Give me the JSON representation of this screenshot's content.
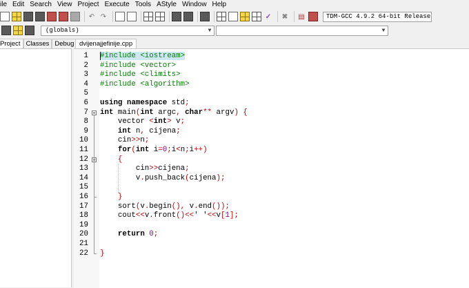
{
  "menu": [
    "ile",
    "Edit",
    "Search",
    "View",
    "Project",
    "Execute",
    "Tools",
    "AStyle",
    "Window",
    "Help"
  ],
  "toolbar": {
    "compiler": "TDM-GCC 4.9.2 64-bit Release"
  },
  "toolbar2": {
    "scope": "(globals)"
  },
  "left_tabs": [
    "Project",
    "Classes",
    "Debug"
  ],
  "file_tab": "dvijenajjefinije.cpp",
  "line_numbers": [
    "1",
    "2",
    "3",
    "4",
    "5",
    "6",
    "7",
    "8",
    "9",
    "10",
    "11",
    "12",
    "13",
    "14",
    "15",
    "16",
    "17",
    "18",
    "19",
    "20",
    "21",
    "22"
  ],
  "code_lines": [
    [
      {
        "t": "pp",
        "v": "#include <iostream>"
      }
    ],
    [
      {
        "t": "pp",
        "v": "#include <vector>"
      }
    ],
    [
      {
        "t": "pp",
        "v": "#include <climits>"
      }
    ],
    [
      {
        "t": "pp",
        "v": "#include <algorithm>"
      }
    ],
    [],
    [
      {
        "t": "kw",
        "v": "using namespace"
      },
      {
        "t": "txt",
        "v": " std"
      },
      {
        "t": "sym",
        "v": ";"
      }
    ],
    [
      {
        "t": "kw",
        "v": "int"
      },
      {
        "t": "txt",
        "v": " main"
      },
      {
        "t": "sym",
        "v": "("
      },
      {
        "t": "kw",
        "v": "int"
      },
      {
        "t": "txt",
        "v": " argc"
      },
      {
        "t": "sym",
        "v": ", "
      },
      {
        "t": "kw",
        "v": "char"
      },
      {
        "t": "sym",
        "v": "**"
      },
      {
        "t": "txt",
        "v": " argv"
      },
      {
        "t": "sym",
        "v": ") {"
      }
    ],
    [
      {
        "t": "txt",
        "v": "    vector "
      },
      {
        "t": "sym",
        "v": "<"
      },
      {
        "t": "kw",
        "v": "int"
      },
      {
        "t": "sym",
        "v": ">"
      },
      {
        "t": "txt",
        "v": " v"
      },
      {
        "t": "sym",
        "v": ";"
      }
    ],
    [
      {
        "t": "txt",
        "v": "    "
      },
      {
        "t": "kw",
        "v": "int"
      },
      {
        "t": "txt",
        "v": " n"
      },
      {
        "t": "sym",
        "v": ","
      },
      {
        "t": "txt",
        "v": " cijena"
      },
      {
        "t": "sym",
        "v": ";"
      }
    ],
    [
      {
        "t": "txt",
        "v": "    cin"
      },
      {
        "t": "sym",
        "v": ">>"
      },
      {
        "t": "txt",
        "v": "n"
      },
      {
        "t": "sym",
        "v": ";"
      }
    ],
    [
      {
        "t": "txt",
        "v": "    "
      },
      {
        "t": "kw",
        "v": "for"
      },
      {
        "t": "sym",
        "v": "("
      },
      {
        "t": "kw",
        "v": "int"
      },
      {
        "t": "txt",
        "v": " i"
      },
      {
        "t": "sym",
        "v": "="
      },
      {
        "t": "num",
        "v": "0"
      },
      {
        "t": "sym",
        "v": ";"
      },
      {
        "t": "txt",
        "v": "i"
      },
      {
        "t": "sym",
        "v": "<"
      },
      {
        "t": "txt",
        "v": "n"
      },
      {
        "t": "sym",
        "v": ";"
      },
      {
        "t": "txt",
        "v": "i"
      },
      {
        "t": "sym",
        "v": "++)"
      }
    ],
    [
      {
        "t": "txt",
        "v": "    "
      },
      {
        "t": "sym",
        "v": "{"
      }
    ],
    [
      {
        "t": "txt",
        "v": "        cin"
      },
      {
        "t": "sym",
        "v": ">>"
      },
      {
        "t": "txt",
        "v": "cijena"
      },
      {
        "t": "sym",
        "v": ";"
      }
    ],
    [
      {
        "t": "txt",
        "v": "        v"
      },
      {
        "t": "sym",
        "v": "."
      },
      {
        "t": "txt",
        "v": "push_back"
      },
      {
        "t": "sym",
        "v": "("
      },
      {
        "t": "txt",
        "v": "cijena"
      },
      {
        "t": "sym",
        "v": ");"
      }
    ],
    [],
    [
      {
        "t": "txt",
        "v": "    "
      },
      {
        "t": "sym",
        "v": "}"
      }
    ],
    [
      {
        "t": "txt",
        "v": "    sort"
      },
      {
        "t": "sym",
        "v": "("
      },
      {
        "t": "txt",
        "v": "v"
      },
      {
        "t": "sym",
        "v": "."
      },
      {
        "t": "txt",
        "v": "begin"
      },
      {
        "t": "sym",
        "v": "(), "
      },
      {
        "t": "txt",
        "v": "v"
      },
      {
        "t": "sym",
        "v": "."
      },
      {
        "t": "txt",
        "v": "end"
      },
      {
        "t": "sym",
        "v": "());"
      }
    ],
    [
      {
        "t": "txt",
        "v": "    cout"
      },
      {
        "t": "sym",
        "v": "<<"
      },
      {
        "t": "txt",
        "v": "v"
      },
      {
        "t": "sym",
        "v": "."
      },
      {
        "t": "txt",
        "v": "front"
      },
      {
        "t": "sym",
        "v": "()<<"
      },
      {
        "t": "txt",
        "v": "' '"
      },
      {
        "t": "sym",
        "v": "<<"
      },
      {
        "t": "txt",
        "v": "v"
      },
      {
        "t": "sym",
        "v": "["
      },
      {
        "t": "num",
        "v": "1"
      },
      {
        "t": "sym",
        "v": "];"
      }
    ],
    [],
    [
      {
        "t": "txt",
        "v": "    "
      },
      {
        "t": "kw",
        "v": "return"
      },
      {
        "t": "txt",
        "v": " "
      },
      {
        "t": "num",
        "v": "0"
      },
      {
        "t": "sym",
        "v": ";"
      }
    ],
    [],
    [
      {
        "t": "sym",
        "v": "}"
      }
    ]
  ],
  "fold_markers": [
    "7",
    "12"
  ],
  "colors": {
    "preprocessor": "#008000",
    "symbol": "#c00000",
    "number": "#800080",
    "current_line_highlight": "#cde8f2"
  }
}
